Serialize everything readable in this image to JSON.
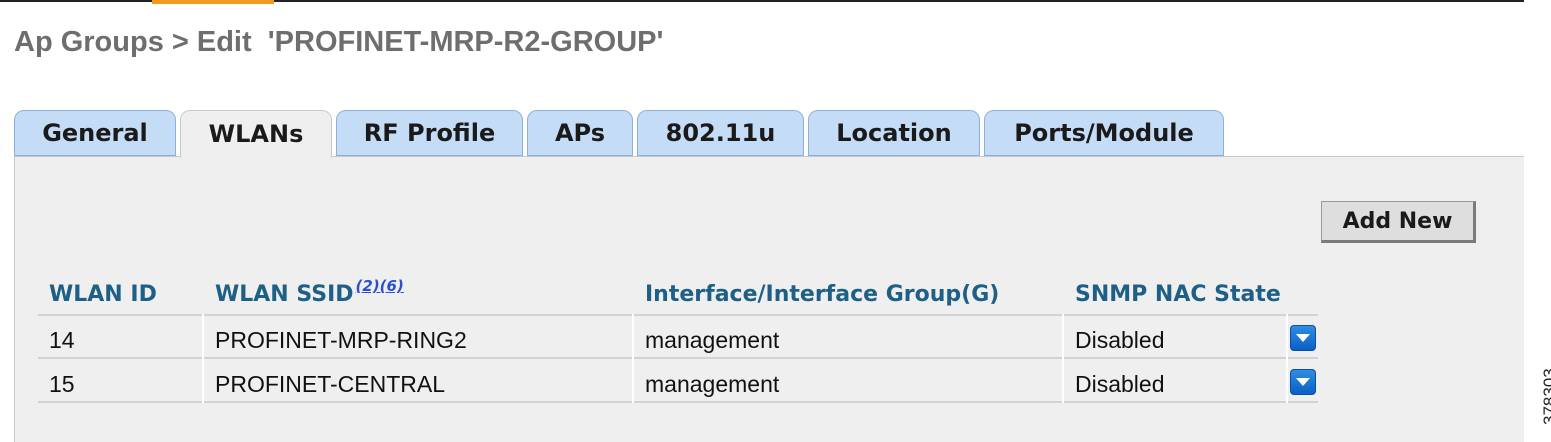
{
  "page": {
    "title": "Ap Groups > Edit  'PROFINET-MRP-R2-GROUP'",
    "side_label": "378303"
  },
  "tabs": [
    {
      "label": "General",
      "active": false
    },
    {
      "label": "WLANs",
      "active": true
    },
    {
      "label": "RF Profile",
      "active": false
    },
    {
      "label": "APs",
      "active": false
    },
    {
      "label": "802.11u",
      "active": false
    },
    {
      "label": "Location",
      "active": false
    },
    {
      "label": "Ports/Module",
      "active": false
    }
  ],
  "toolbar": {
    "add_new_label": "Add New"
  },
  "table": {
    "headers": {
      "wlan_id": "WLAN ID",
      "wlan_ssid": "WLAN SSID",
      "ssid_note_links": "(2)(6)",
      "interface": "Interface/Interface Group(G)",
      "snmp_nac": "SNMP NAC State"
    },
    "rows": [
      {
        "wlan_id": "14",
        "ssid": "PROFINET-MRP-RING2",
        "interface": "management",
        "snmp_nac": "Disabled"
      },
      {
        "wlan_id": "15",
        "ssid": "PROFINET-CENTRAL",
        "interface": "management",
        "snmp_nac": "Disabled"
      }
    ]
  },
  "colors": {
    "tab_bg": "#c5dcf6",
    "panel_bg": "#efefef",
    "header_text": "#1d5f86",
    "accent": "#f39a1e",
    "dropdown_blue": "#1a73d8"
  },
  "icons": {
    "row_menu": "chevron-down-icon"
  }
}
